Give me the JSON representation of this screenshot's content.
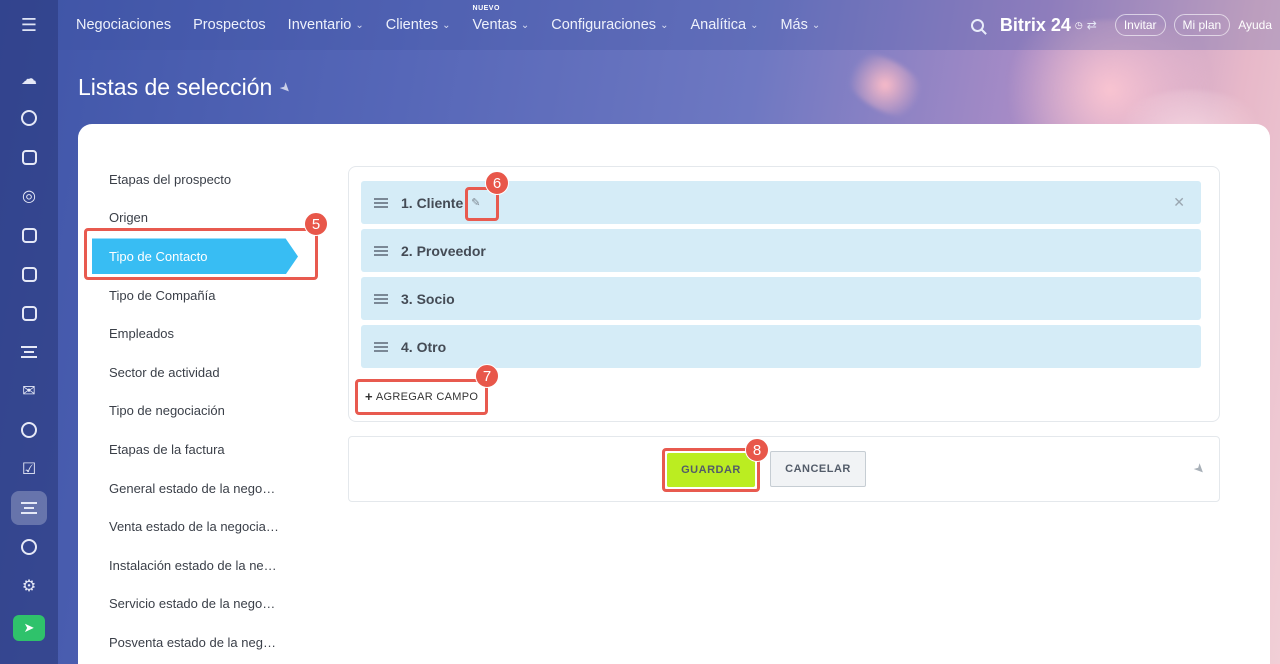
{
  "topbar": {
    "menu_icon": "hamburger-icon",
    "nav": [
      {
        "label": "Negociaciones",
        "dropdown": false
      },
      {
        "label": "Prospectos",
        "dropdown": false
      },
      {
        "label": "Inventario",
        "dropdown": true
      },
      {
        "label": "Clientes",
        "dropdown": true
      },
      {
        "label": "Ventas",
        "dropdown": true,
        "badge": "NUEVO"
      },
      {
        "label": "Configuraciones",
        "dropdown": true
      },
      {
        "label": "Analítica",
        "dropdown": true
      },
      {
        "label": "Más",
        "dropdown": true
      }
    ],
    "brand": "Bitrix 24",
    "invite": "Invitar",
    "plan": "Mi plan",
    "help": "Ayuda"
  },
  "rail": {
    "icons": [
      "cloud-icon",
      "chat-icon",
      "feed-icon",
      "target-icon",
      "calendar-icon",
      "document-icon",
      "presentation-icon",
      "inbox-icon",
      "mail-icon",
      "contacts-icon",
      "tasks-icon",
      "crm-funnel-icon",
      "robot-icon",
      "settings-icon",
      "rocket-icon"
    ],
    "active_index": 11
  },
  "page": {
    "title": "Listas de selección"
  },
  "sidebar": {
    "items": [
      "Etapas del prospecto",
      "Origen",
      "Tipo de Contacto",
      "Tipo de Compañía",
      "Empleados",
      "Sector de actividad",
      "Tipo de negociación",
      "Etapas de la factura",
      "General estado de la nego…",
      "Venta estado de la negocia…",
      "Instalación estado de la ne…",
      "Servicio estado de la nego…",
      "Posventa estado de la neg…"
    ],
    "active_index": 2
  },
  "list": {
    "rows": [
      "1. Cliente",
      "2. Proveedor",
      "3. Socio",
      "4. Otro"
    ],
    "add_label": "AGREGAR CAMPO"
  },
  "actions": {
    "save": "GUARDAR",
    "cancel": "CANCELAR"
  },
  "annotations": {
    "steps": [
      "5",
      "6",
      "7",
      "8"
    ],
    "highlight_color": "#e85a4f"
  },
  "colors": {
    "active_item": "#38bdf3",
    "row_bg": "#d5ecf7",
    "save_bg": "#bbed21"
  }
}
